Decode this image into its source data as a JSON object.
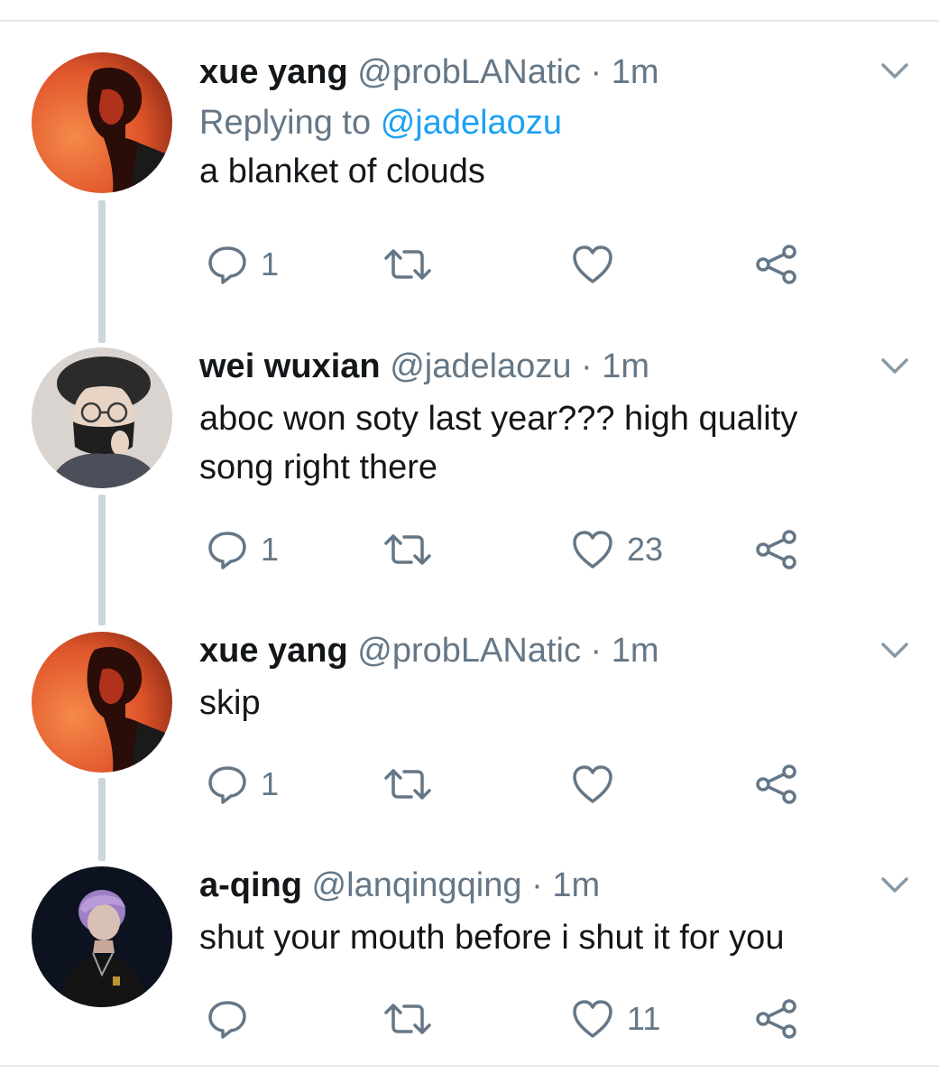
{
  "tweets": [
    {
      "name": "xue yang",
      "handle": "@probLANatic",
      "separator": "·",
      "time": "1m",
      "reply_prefix": "Replying to",
      "reply_mention": "@jadelaozu",
      "text": [
        "a blanket of clouds"
      ],
      "replies": "1",
      "retweets": "",
      "likes": ""
    },
    {
      "name": "wei wuxian",
      "handle": "@jadelaozu",
      "separator": "·",
      "time": "1m",
      "text": [
        "aboc won soty last year??? high quality",
        "song right there"
      ],
      "replies": "1",
      "retweets": "",
      "likes": "23"
    },
    {
      "name": "xue yang",
      "handle": "@probLANatic",
      "separator": "·",
      "time": "1m",
      "text": [
        "skip"
      ],
      "replies": "1",
      "retweets": "",
      "likes": ""
    },
    {
      "name": "a-qing",
      "handle": "@lanqingqing",
      "separator": "·",
      "time": "1m",
      "text": [
        "shut your mouth before i shut it for you"
      ],
      "replies": "",
      "retweets": "",
      "likes": "11"
    }
  ],
  "icons": {
    "reply": "reply-icon",
    "retweet": "retweet-icon",
    "like": "heart-icon",
    "share": "share-icon",
    "menu": "chevron-down-icon"
  },
  "colors": {
    "text": "#14171a",
    "secondary": "#657786",
    "link": "#1da1f2",
    "thread_line": "#ccd6dd",
    "divider": "#e1e8ed"
  }
}
